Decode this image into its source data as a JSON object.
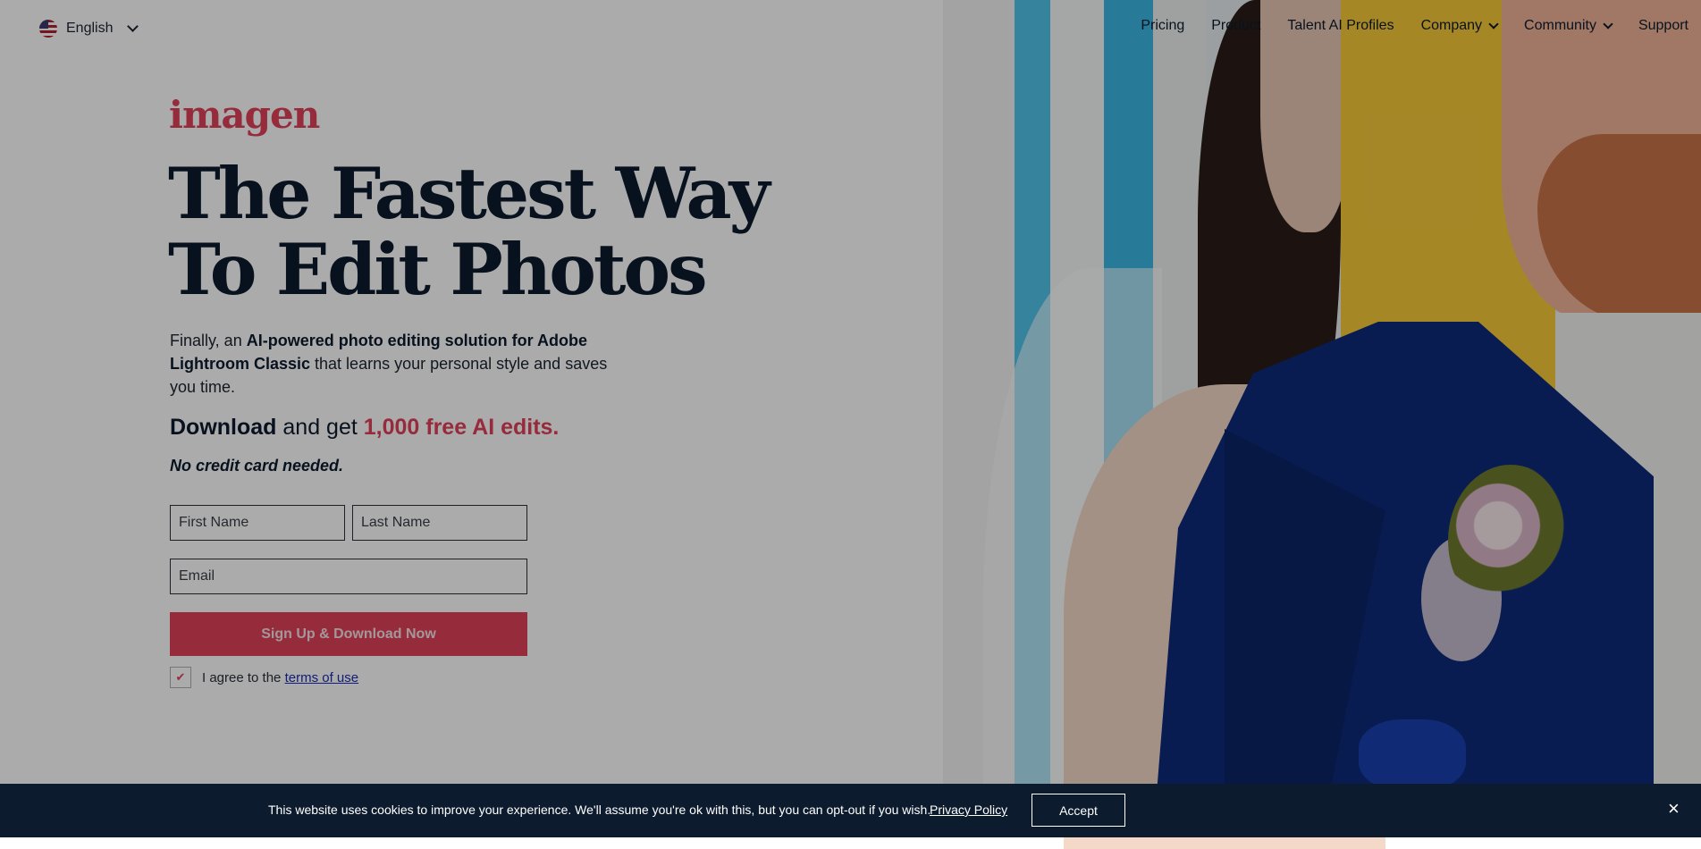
{
  "nav": {
    "language": "English",
    "items": [
      {
        "label": "Pricing",
        "has_dropdown": false
      },
      {
        "label": "Product",
        "has_dropdown": false
      },
      {
        "label": "Talent AI Profiles",
        "has_dropdown": false
      },
      {
        "label": "Company",
        "has_dropdown": true
      },
      {
        "label": "Community",
        "has_dropdown": true
      },
      {
        "label": "Support",
        "has_dropdown": false
      }
    ]
  },
  "hero": {
    "logo": "imagen",
    "title_line1": "The Fastest Way",
    "title_line2": "To Edit Photos",
    "desc_prefix": "Finally, an ",
    "desc_bold": "AI-powered photo editing solution for Adobe Lightroom Classic",
    "desc_suffix": " that learns your personal style and saves you time.",
    "download_bold": "Download",
    "download_mid": " and get ",
    "download_red": "1,000 free AI edits.",
    "no_credit": "No credit card needed."
  },
  "form": {
    "first_name_placeholder": "First Name",
    "last_name_placeholder": "Last Name",
    "email_placeholder": "Email",
    "submit_label": "Sign Up & Download Now",
    "agree_prefix": "I agree to the ",
    "terms_label": "terms of use",
    "agree_checked": true
  },
  "cookie": {
    "text": "This website uses cookies to improve your experience. We'll assume you're ok with this, but you can opt-out if you wish.",
    "privacy_label": "Privacy Policy",
    "accept_label": "Accept",
    "close_symbol": "×"
  },
  "colors": {
    "brand_red": "#e0415a",
    "navy": "#0d1b2e",
    "link_blue": "#1a2ab8"
  }
}
